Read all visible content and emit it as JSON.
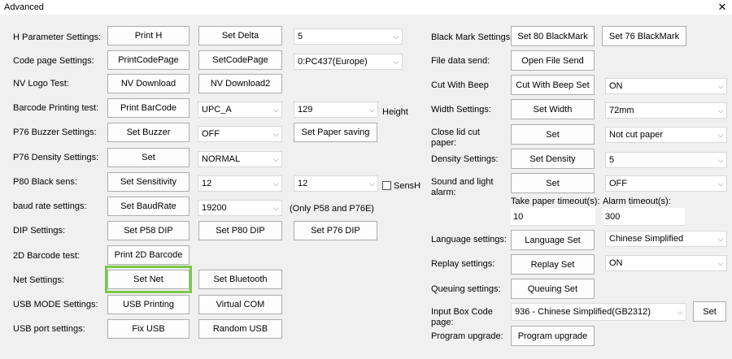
{
  "window": {
    "title": "Advanced",
    "close_glyph": "✕"
  },
  "left_labels": [
    "H Parameter Settings:",
    "Code page Settings:",
    "NV Logo Test:",
    "Barcode Printing test:",
    "P76 Buzzer Settings:",
    "P76 Density Settings:",
    "P80 Black sens:",
    "baud rate settings:",
    "DIP Settings:",
    "2D Barcode test:",
    "Net Settings:",
    "USB MODE Settings:",
    "USB port settings:"
  ],
  "left_buttons": {
    "print_h": "Print H",
    "set_delta": "Set Delta",
    "print_codepage": "PrintCodePage",
    "set_codepage": "SetCodePage",
    "nv_download": "NV Download",
    "nv_download2": "NV Download2",
    "print_barcode": "Print BarCode",
    "set_buzzer": "Set Buzzer",
    "set_paper_saving": "Set Paper saving",
    "set_density": "Set",
    "set_sensitivity": "Set Sensitivity",
    "set_baudrate": "Set BaudRate",
    "set_p58_dip": "Set P58 DIP",
    "set_p80_dip": "Set P80 DIP",
    "set_p76_dip": "Set P76 DIP",
    "print_2d_barcode": "Print 2D Barcode",
    "set_net": "Set Net",
    "set_bluetooth": "Set Bluetooth",
    "usb_printing": "USB Printing",
    "virtual_com": "Virtual COM",
    "fix_usb": "Fix USB",
    "random_usb": "Random USB"
  },
  "left_combos": {
    "h_param": "5",
    "codepage": "0:PC437(Europe)",
    "barcode_type": "UPC_A",
    "barcode_height": "129",
    "buzzer": "OFF",
    "density": "NORMAL",
    "sens_1": "12",
    "sens_2": "12",
    "baudrate": "19200"
  },
  "left_misc": {
    "height_label": "Height",
    "sensh_label": "SensH",
    "baud_note": "(Only P58 and P76E)"
  },
  "right_labels": {
    "black_mark": "Black Mark Settings:",
    "file_data_send": "File data send:",
    "cut_with_beep": "Cut With Beep",
    "width": "Width Settings:",
    "close_lid": "Close lid cut paper:",
    "density": "Density Settings:",
    "sound_light": "Sound and light alarm:",
    "take_paper_timeout": "Take paper timeout(s):",
    "alarm_timeout": "Alarm timeout(s):",
    "language": "Language settings:",
    "replay": "Replay settings:",
    "queuing": "Queuing settings:",
    "input_box_codepage": "Input Box Code page:",
    "program_upgrade": "Program upgrade:"
  },
  "right_buttons": {
    "set_80_blackmark": "Set 80 BlackMark",
    "set_76_blackmark": "Set 76 BlackMark",
    "open_file_send": "Open File Send",
    "cut_with_beep_set": "Cut With Beep Set",
    "set_width": "Set Width",
    "set_close_lid": "Set",
    "set_density": "Set Density",
    "set_sound_light": "Set",
    "language_set": "Language Set",
    "replay_set": "Replay Set",
    "queuing_set": "Queuing Set",
    "set_codepage": "Set",
    "program_upgrade": "Program upgrade"
  },
  "right_combos": {
    "cut_with_beep": "ON",
    "width": "72mm",
    "close_lid": "Not cut paper",
    "density": "5",
    "sound_light": "OFF",
    "language": "Chinese Simplified",
    "replay": "ON",
    "input_codepage": "936 - Chinese Simplified(GB2312)"
  },
  "right_inputs": {
    "take_paper_timeout": "10",
    "alarm_timeout": "300"
  },
  "icons": {
    "dropdown_arrow": "⌵"
  },
  "colors": {
    "highlight": "#7ac943"
  }
}
